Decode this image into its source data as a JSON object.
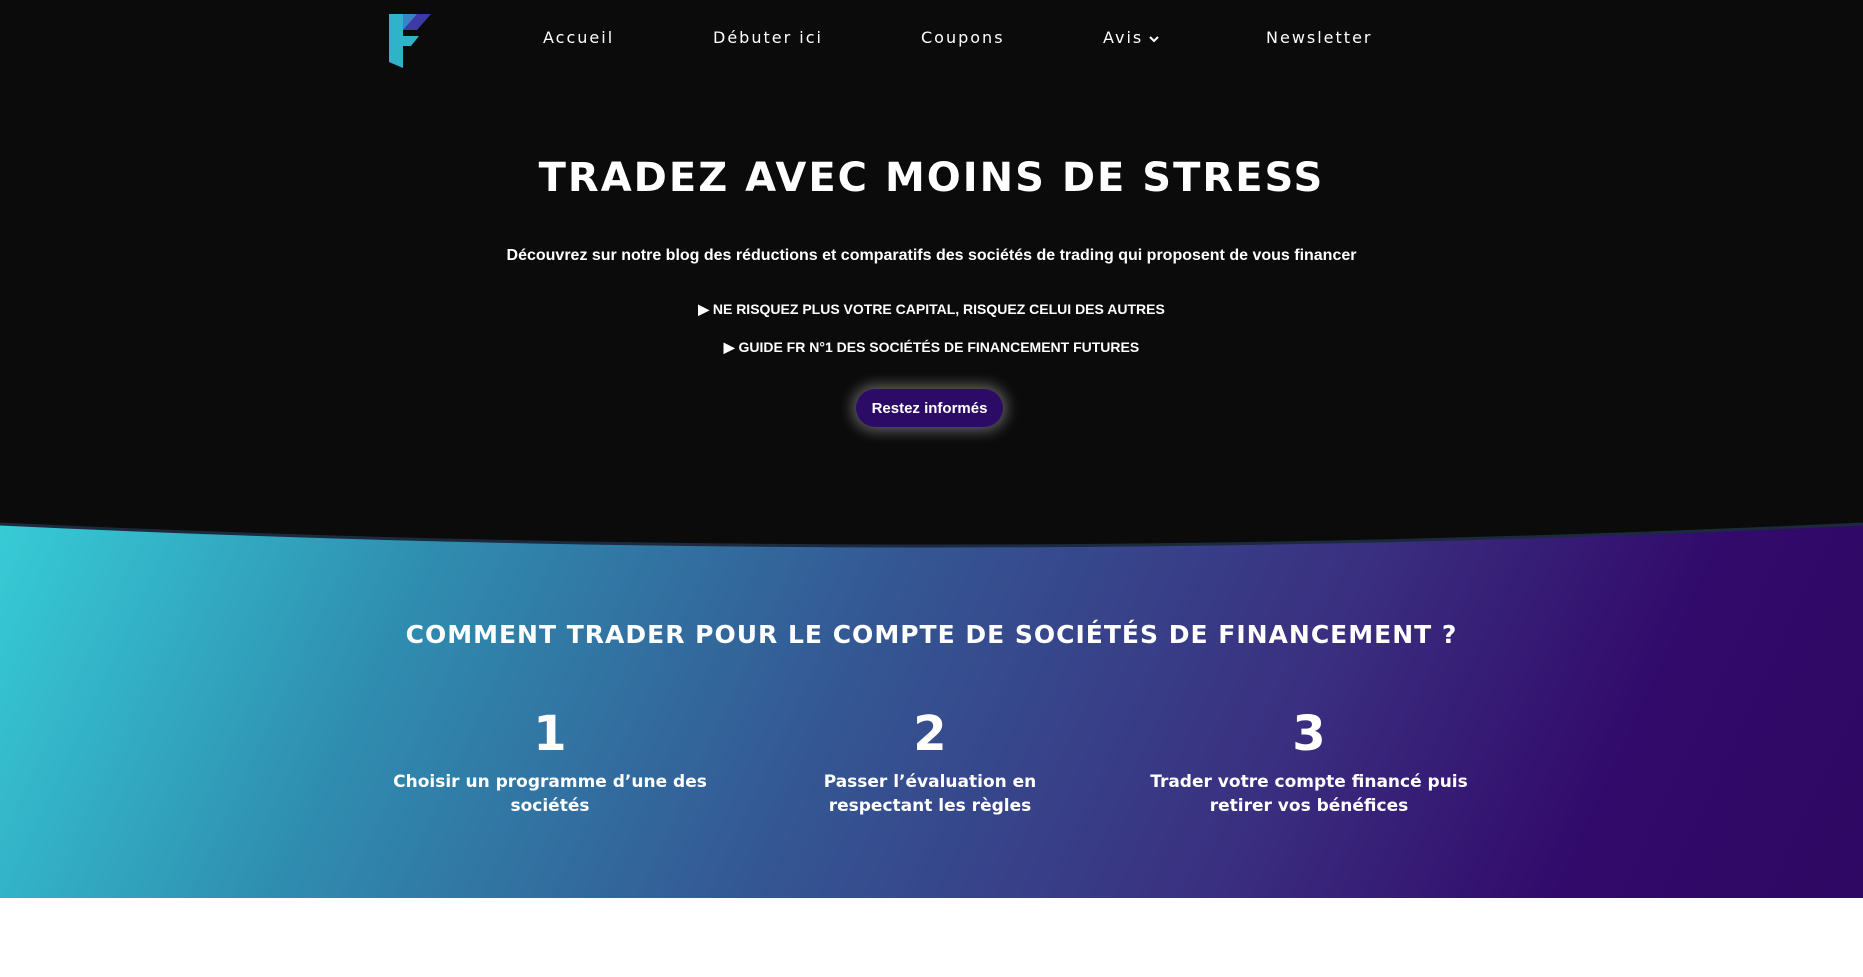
{
  "nav": {
    "items": [
      {
        "label": "Accueil"
      },
      {
        "label": "Débuter ici"
      },
      {
        "label": "Coupons"
      },
      {
        "label": "Avis"
      },
      {
        "label": "Newsletter"
      }
    ]
  },
  "hero": {
    "title": "TRADEZ AVEC MOINS DE STRESS",
    "subtitle": "Découvrez sur notre blog des réductions et comparatifs des sociétés de trading qui proposent de vous financer",
    "bullets": [
      "▶ NE RISQUEZ PLUS VOTRE CAPITAL, RISQUEZ CELUI DES AUTRES",
      "▶ GUIDE FR N°1 DES SOCIÉTÉS DE FINANCEMENT FUTURES"
    ],
    "cta_label": "Restez informés"
  },
  "steps": {
    "title": "COMMENT TRADER POUR LE COMPTE DE SOCIÉTÉS DE FINANCEMENT ?",
    "items": [
      {
        "number": "1",
        "text": "Choisir un programme d’une des sociétés"
      },
      {
        "number": "2",
        "text": "Passer l’évaluation en respectant les règles"
      },
      {
        "number": "3",
        "text": "Trader votre compte financé puis retirer vos bénéfices"
      }
    ]
  },
  "colors": {
    "hero_background": "#0b0b0c",
    "cta_background": "#2c0b66",
    "gradient_start": "#36ccd6",
    "gradient_end": "#2e0863",
    "logo_teal": "#2fb3c9",
    "logo_purple": "#3d3aa8"
  },
  "icons": {
    "logo": "brand-f-logo-icon",
    "nav_dropdown": "chevron-down-icon"
  }
}
